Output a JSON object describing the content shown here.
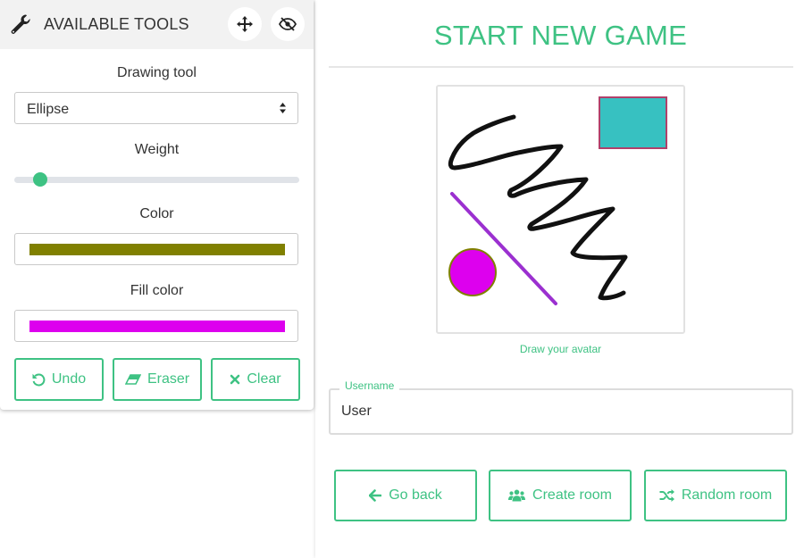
{
  "tools_panel": {
    "title": "AVAILABLE TOOLS",
    "icons": {
      "header": "wrench-icon",
      "move": "move-arrows-icon",
      "hide": "eye-slash-icon"
    },
    "drawing_tool": {
      "label": "Drawing tool",
      "selected": "Ellipse"
    },
    "weight": {
      "label": "Weight",
      "value_fraction": 0.07
    },
    "color": {
      "label": "Color",
      "value": "#808000"
    },
    "fill_color": {
      "label": "Fill color",
      "value": "#dd00ee"
    },
    "buttons": {
      "undo": "Undo",
      "eraser": "Eraser",
      "clear": "Clear"
    }
  },
  "main": {
    "title": "START NEW GAME",
    "avatar_caption": "Draw your avatar",
    "username": {
      "legend": "Username",
      "value": "User"
    },
    "buttons": {
      "go_back": "Go back",
      "create_room": "Create room",
      "random_room": "Random room"
    }
  },
  "colors": {
    "accent": "#3ec283",
    "text": "#333333"
  }
}
